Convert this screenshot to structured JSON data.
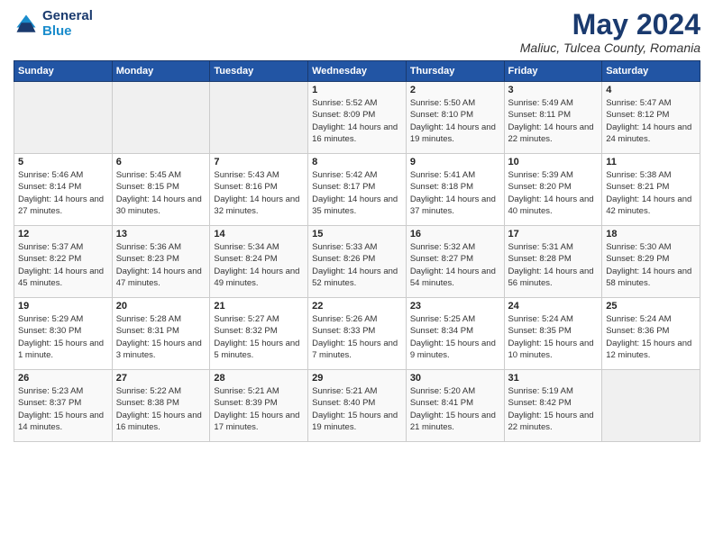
{
  "logo": {
    "line1": "General",
    "line2": "Blue"
  },
  "title": "May 2024",
  "subtitle": "Maliuc, Tulcea County, Romania",
  "days_of_week": [
    "Sunday",
    "Monday",
    "Tuesday",
    "Wednesday",
    "Thursday",
    "Friday",
    "Saturday"
  ],
  "weeks": [
    [
      {
        "day": "",
        "info": ""
      },
      {
        "day": "",
        "info": ""
      },
      {
        "day": "",
        "info": ""
      },
      {
        "day": "1",
        "info": "Sunrise: 5:52 AM\nSunset: 8:09 PM\nDaylight: 14 hours and 16 minutes."
      },
      {
        "day": "2",
        "info": "Sunrise: 5:50 AM\nSunset: 8:10 PM\nDaylight: 14 hours and 19 minutes."
      },
      {
        "day": "3",
        "info": "Sunrise: 5:49 AM\nSunset: 8:11 PM\nDaylight: 14 hours and 22 minutes."
      },
      {
        "day": "4",
        "info": "Sunrise: 5:47 AM\nSunset: 8:12 PM\nDaylight: 14 hours and 24 minutes."
      }
    ],
    [
      {
        "day": "5",
        "info": "Sunrise: 5:46 AM\nSunset: 8:14 PM\nDaylight: 14 hours and 27 minutes."
      },
      {
        "day": "6",
        "info": "Sunrise: 5:45 AM\nSunset: 8:15 PM\nDaylight: 14 hours and 30 minutes."
      },
      {
        "day": "7",
        "info": "Sunrise: 5:43 AM\nSunset: 8:16 PM\nDaylight: 14 hours and 32 minutes."
      },
      {
        "day": "8",
        "info": "Sunrise: 5:42 AM\nSunset: 8:17 PM\nDaylight: 14 hours and 35 minutes."
      },
      {
        "day": "9",
        "info": "Sunrise: 5:41 AM\nSunset: 8:18 PM\nDaylight: 14 hours and 37 minutes."
      },
      {
        "day": "10",
        "info": "Sunrise: 5:39 AM\nSunset: 8:20 PM\nDaylight: 14 hours and 40 minutes."
      },
      {
        "day": "11",
        "info": "Sunrise: 5:38 AM\nSunset: 8:21 PM\nDaylight: 14 hours and 42 minutes."
      }
    ],
    [
      {
        "day": "12",
        "info": "Sunrise: 5:37 AM\nSunset: 8:22 PM\nDaylight: 14 hours and 45 minutes."
      },
      {
        "day": "13",
        "info": "Sunrise: 5:36 AM\nSunset: 8:23 PM\nDaylight: 14 hours and 47 minutes."
      },
      {
        "day": "14",
        "info": "Sunrise: 5:34 AM\nSunset: 8:24 PM\nDaylight: 14 hours and 49 minutes."
      },
      {
        "day": "15",
        "info": "Sunrise: 5:33 AM\nSunset: 8:26 PM\nDaylight: 14 hours and 52 minutes."
      },
      {
        "day": "16",
        "info": "Sunrise: 5:32 AM\nSunset: 8:27 PM\nDaylight: 14 hours and 54 minutes."
      },
      {
        "day": "17",
        "info": "Sunrise: 5:31 AM\nSunset: 8:28 PM\nDaylight: 14 hours and 56 minutes."
      },
      {
        "day": "18",
        "info": "Sunrise: 5:30 AM\nSunset: 8:29 PM\nDaylight: 14 hours and 58 minutes."
      }
    ],
    [
      {
        "day": "19",
        "info": "Sunrise: 5:29 AM\nSunset: 8:30 PM\nDaylight: 15 hours and 1 minute."
      },
      {
        "day": "20",
        "info": "Sunrise: 5:28 AM\nSunset: 8:31 PM\nDaylight: 15 hours and 3 minutes."
      },
      {
        "day": "21",
        "info": "Sunrise: 5:27 AM\nSunset: 8:32 PM\nDaylight: 15 hours and 5 minutes."
      },
      {
        "day": "22",
        "info": "Sunrise: 5:26 AM\nSunset: 8:33 PM\nDaylight: 15 hours and 7 minutes."
      },
      {
        "day": "23",
        "info": "Sunrise: 5:25 AM\nSunset: 8:34 PM\nDaylight: 15 hours and 9 minutes."
      },
      {
        "day": "24",
        "info": "Sunrise: 5:24 AM\nSunset: 8:35 PM\nDaylight: 15 hours and 10 minutes."
      },
      {
        "day": "25",
        "info": "Sunrise: 5:24 AM\nSunset: 8:36 PM\nDaylight: 15 hours and 12 minutes."
      }
    ],
    [
      {
        "day": "26",
        "info": "Sunrise: 5:23 AM\nSunset: 8:37 PM\nDaylight: 15 hours and 14 minutes."
      },
      {
        "day": "27",
        "info": "Sunrise: 5:22 AM\nSunset: 8:38 PM\nDaylight: 15 hours and 16 minutes."
      },
      {
        "day": "28",
        "info": "Sunrise: 5:21 AM\nSunset: 8:39 PM\nDaylight: 15 hours and 17 minutes."
      },
      {
        "day": "29",
        "info": "Sunrise: 5:21 AM\nSunset: 8:40 PM\nDaylight: 15 hours and 19 minutes."
      },
      {
        "day": "30",
        "info": "Sunrise: 5:20 AM\nSunset: 8:41 PM\nDaylight: 15 hours and 21 minutes."
      },
      {
        "day": "31",
        "info": "Sunrise: 5:19 AM\nSunset: 8:42 PM\nDaylight: 15 hours and 22 minutes."
      },
      {
        "day": "",
        "info": ""
      }
    ]
  ]
}
